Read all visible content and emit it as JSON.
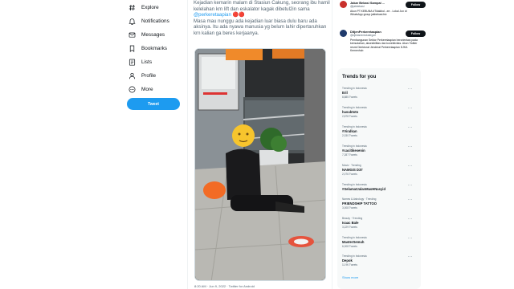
{
  "nav": {
    "items": [
      {
        "label": "Explore",
        "icon": "hashtag-icon"
      },
      {
        "label": "Notifications",
        "icon": "bell-icon"
      },
      {
        "label": "Messages",
        "icon": "envelope-icon"
      },
      {
        "label": "Bookmarks",
        "icon": "bookmark-icon"
      },
      {
        "label": "Lists",
        "icon": "list-icon"
      },
      {
        "label": "Profile",
        "icon": "person-icon"
      },
      {
        "label": "More",
        "icon": "more-circle-icon"
      }
    ],
    "tweet_button": "Tweet"
  },
  "tweet": {
    "text_1": "Kejadian kemarin malam di Stasiun Cakung, seorang ibu hamil kelelahan krn lift dan eskalator kagak dibetul2in sama ",
    "mention": "@perkeretaapian",
    "emoji": " 🔴🔴",
    "text_2": "Masa mau nunggu ada kejadian luar biasa dulu baru ada aksinya. Itu ada nyawa manusia yg belum lahir dipertaruhkan krn kalian ga beres kerjaanya.",
    "timestamp": "8:20 AM · Jun 9, 2022 · Twitter for Android"
  },
  "who_to_follow": [
    {
      "name": "Jakar Bekasi Sampai ...",
      "handle": "@jakbekasi",
      "bio": "Akun PT.KEBUNA #Tidakbol...ee - Lokal Jun di WhatsApp group jakbekasi.biz",
      "button": "Follow",
      "color": "#c9302c"
    },
    {
      "name": "DitjenPerkeretaapian",
      "handle": "@djkhanentokategori",
      "bio": "Pembangunan Sektor Perkeretaapian berorientasi pada kemudahan, aksesibilitas dan konektivitas. Akun Twitter resmi Direktorat Jenderal Perkeretaapian DJKA Kemenhub",
      "button": "Follow",
      "color": "#1f3a6b"
    }
  ],
  "trends": {
    "title": "Trends for you",
    "items": [
      {
        "context": "Trending in Indonesia",
        "name": "Eril",
        "count": "8,885 Tweets"
      },
      {
        "context": "Trending in Indonesia",
        "name": "hasubtoto",
        "count": "2,878 Tweets"
      },
      {
        "context": "Trending in Indonesia",
        "name": "#Viralkan",
        "count": "2,030 Tweets"
      },
      {
        "context": "Trending in Indonesia",
        "name": "#cacitikesenin",
        "count": "7,287 Tweets"
      },
      {
        "context": "Music · Trending",
        "name": "NAMGIS D37",
        "count": "2,076 Tweets"
      },
      {
        "context": "Trending in Indonesia",
        "name": "#SelamatJalanMasHNasyid",
        "count": ""
      },
      {
        "context": "Names & Astrology · Trending",
        "name": "FRIENDSHIP TATTOO",
        "count": "3,008 Tweets"
      },
      {
        "context": "Beauty · Trending",
        "name": "Isaac Bale",
        "count": "3,229 Tweets"
      },
      {
        "context": "Trending in Indonesia",
        "name": "MasterSemuh",
        "count": "6,008 Tweets"
      },
      {
        "context": "Trending in Indonesia",
        "name": "Depok",
        "count": "11.9K Tweets"
      }
    ],
    "show_more": "Show more"
  }
}
